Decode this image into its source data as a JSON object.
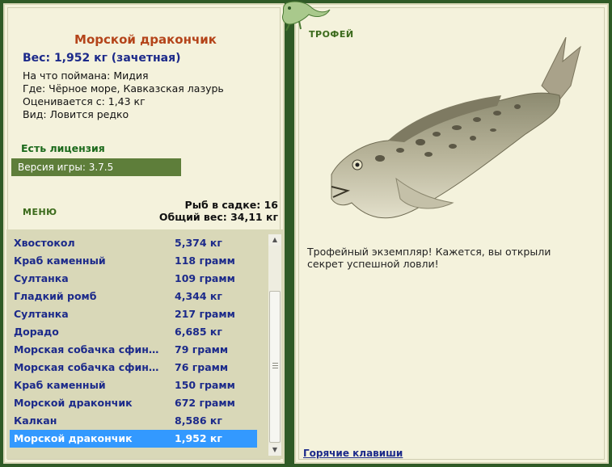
{
  "fish": {
    "title": "Морской дракончик",
    "weight": "Вес: 1,952 кг (зачетная)",
    "bait": "На что поймана: Мидия",
    "location": "Где: Чёрное море, Кавказская лазурь",
    "valued_from": "Оценивается с: 1,43 кг",
    "kind": "Вид: Ловится редко"
  },
  "license": "Есть лицензия",
  "version": "Версия игры: 3.7.5",
  "menu_label": "МЕНЮ",
  "stats": {
    "fish_in_cage": "Рыб в садке: 16",
    "total_weight": "Общий вес: 34,11 кг"
  },
  "list": [
    {
      "name": "Хвостокол",
      "weight": "5,374 кг"
    },
    {
      "name": "Краб каменный",
      "weight": "118 грамм"
    },
    {
      "name": "Султанка",
      "weight": "109 грамм"
    },
    {
      "name": "Гладкий ромб",
      "weight": "4,344 кг"
    },
    {
      "name": "Султанка",
      "weight": "217 грамм"
    },
    {
      "name": "Дорадо",
      "weight": "6,685 кг"
    },
    {
      "name": "Морская собачка сфинкс",
      "weight": "79 грамм"
    },
    {
      "name": "Морская собачка сфинкс",
      "weight": "76 грамм"
    },
    {
      "name": "Краб каменный",
      "weight": "150 грамм"
    },
    {
      "name": "Морской дракончик",
      "weight": "672 грамм"
    },
    {
      "name": "Калкан",
      "weight": "8,586 кг"
    },
    {
      "name": "Морской дракончик",
      "weight": "1,952 кг"
    }
  ],
  "selected_index": 11,
  "trophy": {
    "label": "ТРОФЕЙ",
    "text": "Трофейный экземпляр! Кажется, вы открыли секрет успешной ловли!"
  },
  "hotkeys": "Горячие клавиши",
  "icons": {
    "scroll_up": "scroll-up-arrow-icon",
    "scroll_down": "scroll-down-arrow-icon",
    "fish_image": "fish-photo",
    "decoration": "lizard-icon"
  },
  "colors": {
    "background": "#2f5a26",
    "panel": "#f4f2dc",
    "title": "#b4441a",
    "link": "#1c2a8a",
    "selected": "#3399ff"
  }
}
